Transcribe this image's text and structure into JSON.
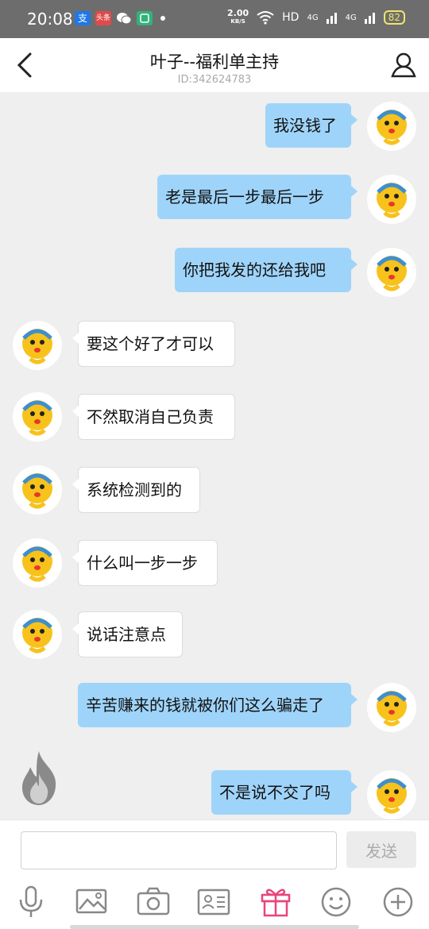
{
  "status_bar": {
    "time": "20:08",
    "net_speed": "2.00",
    "net_unit": "KB/S",
    "hd": "HD",
    "signal1": "4G",
    "signal2": "4G",
    "battery": "82",
    "apps": [
      "支",
      "头条"
    ]
  },
  "header": {
    "title": "叶子--福利单主持",
    "subtitle": "ID:342624783"
  },
  "messages": [
    {
      "side": "out",
      "text": "我没钱了"
    },
    {
      "side": "out",
      "text": "老是最后一步最后一步"
    },
    {
      "side": "out",
      "text": "你把我发的还给我吧"
    },
    {
      "side": "in",
      "text": "要这个好了才可以"
    },
    {
      "side": "in",
      "text": "不然取消自己负责"
    },
    {
      "side": "in",
      "text": "系统检测到的"
    },
    {
      "side": "in",
      "text": "什么叫一步一步"
    },
    {
      "side": "in",
      "text": "说话注意点"
    },
    {
      "side": "out",
      "text": "辛苦赚来的钱就被你们这么骗走了"
    },
    {
      "side": "out",
      "text": "不是说不交了吗"
    }
  ],
  "input": {
    "value": "",
    "send_label": "发送"
  },
  "toolbar": [
    "microphone-icon",
    "image-icon",
    "camera-icon",
    "id-card-icon",
    "gift-icon",
    "emoji-icon",
    "plus-icon"
  ],
  "colors": {
    "outgoing_bubble": "#9fd4fa",
    "incoming_bubble": "#ffffff",
    "gift_accent": "#e8457a"
  }
}
